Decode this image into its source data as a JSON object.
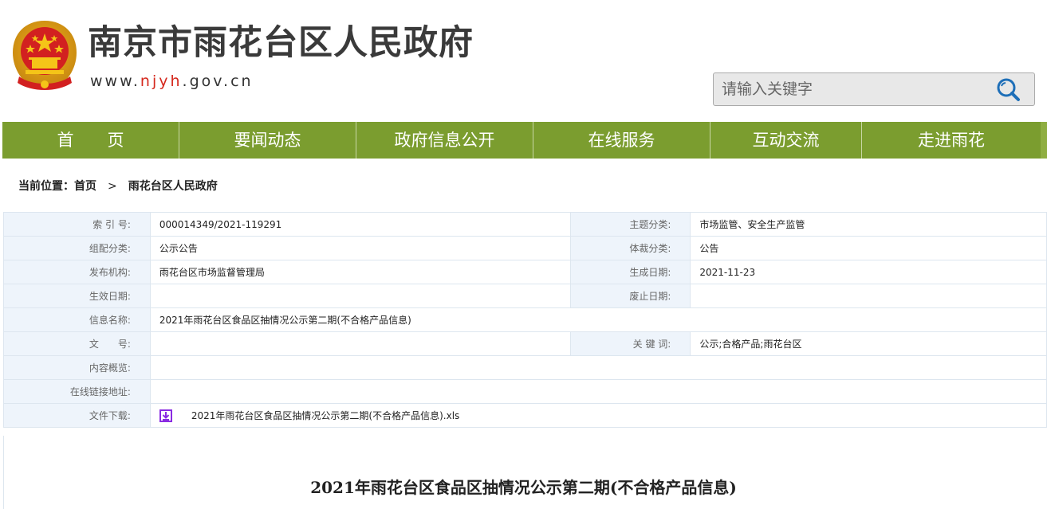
{
  "site": {
    "title": "南京市雨花台区人民政府",
    "url_prefix": "www.",
    "url_highlight": "njyh",
    "url_suffix": ".gov.cn"
  },
  "search": {
    "placeholder": "请输入关键字",
    "icon": "search-icon"
  },
  "nav": [
    {
      "label": "首　　页"
    },
    {
      "label": "要闻动态"
    },
    {
      "label": "政府信息公开"
    },
    {
      "label": "在线服务"
    },
    {
      "label": "互动交流"
    },
    {
      "label": "走进雨花"
    }
  ],
  "breadcrumb": {
    "prefix": "当前位置：",
    "home": "首页",
    "separator": ">",
    "current": "雨花台区人民政府"
  },
  "meta": {
    "index_label": "索 引 号:",
    "index_value": "000014349/2021-119291",
    "topic_label": "主题分类:",
    "topic_value": "市场监管、安全生产监管",
    "org_cat_label": "组配分类:",
    "org_cat_value": "公示公告",
    "genre_label": "体裁分类:",
    "genre_value": "公告",
    "publisher_label": "发布机构:",
    "publisher_value": "雨花台区市场监督管理局",
    "created_label": "生成日期:",
    "created_value": "2021-11-23",
    "effective_label": "生效日期:",
    "effective_value": "",
    "expiry_label": "废止日期:",
    "expiry_value": "",
    "name_label": "信息名称:",
    "name_value": "2021年雨花台区食品区抽情况公示第二期(不合格产品信息)",
    "docno_label": "文　　号:",
    "docno_value": "",
    "keywords_label": "关 键 词:",
    "keywords_value": "公示;合格产品;雨花台区",
    "summary_label": "内容概览:",
    "summary_value": "",
    "link_label": "在线链接地址:",
    "link_value": "",
    "download_label": "文件下载:",
    "download_file": "2021年雨花台区食品区抽情况公示第二期(不合格产品信息).xls"
  },
  "document": {
    "title": "2021年雨花台区食品区抽情况公示第二期(不合格产品信息)"
  },
  "colors": {
    "nav_bg": "#7b9d2f",
    "key_bg": "#eef4fb",
    "url_accent": "#d5281d",
    "download_icon": "#8a2be2"
  }
}
